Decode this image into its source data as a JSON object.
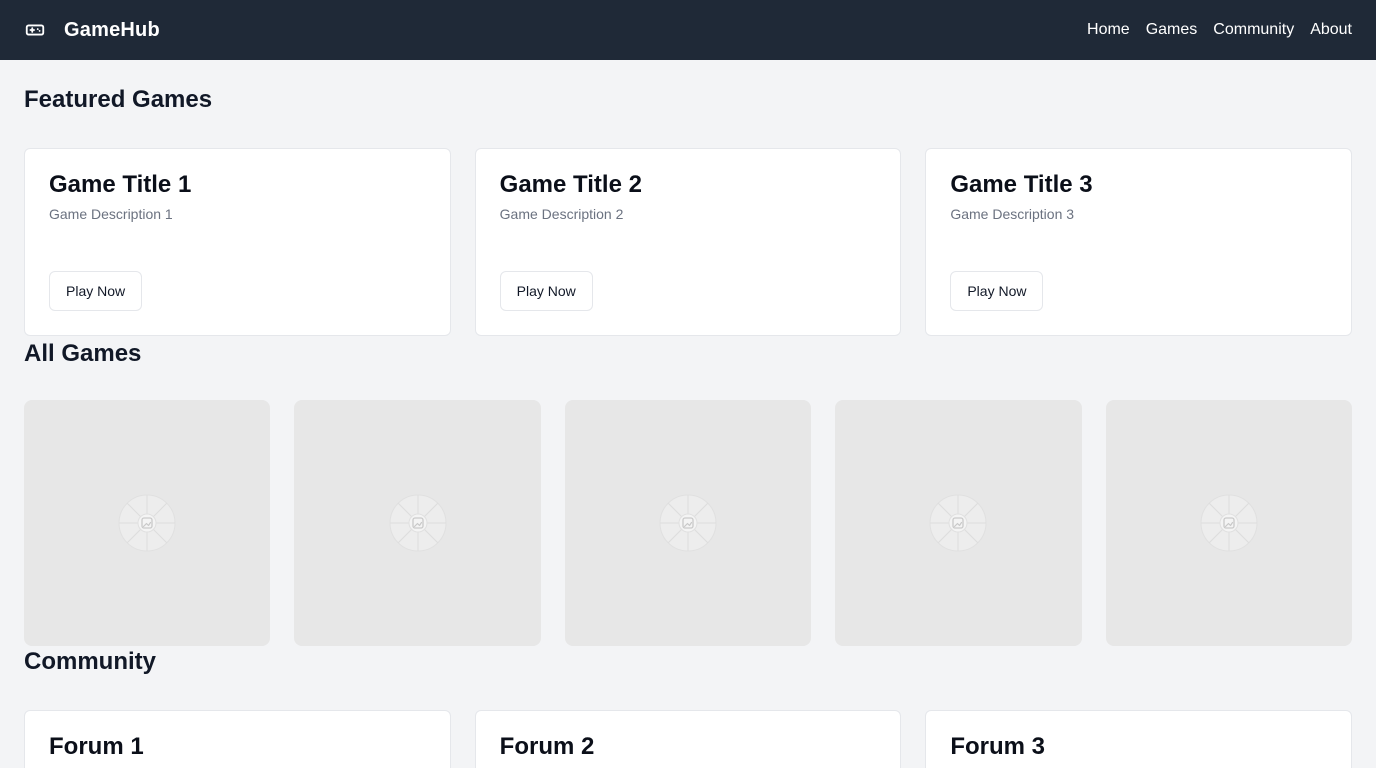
{
  "header": {
    "brand": "GameHub",
    "nav": [
      {
        "label": "Home"
      },
      {
        "label": "Games"
      },
      {
        "label": "Community"
      },
      {
        "label": "About"
      }
    ],
    "colors": {
      "background": "#1f2937",
      "text": "#ffffff"
    }
  },
  "featured": {
    "title": "Featured Games",
    "cards": [
      {
        "title": "Game Title 1",
        "description": "Game Description 1",
        "button": "Play Now"
      },
      {
        "title": "Game Title 2",
        "description": "Game Description 2",
        "button": "Play Now"
      },
      {
        "title": "Game Title 3",
        "description": "Game Description 3",
        "button": "Play Now"
      }
    ]
  },
  "all_games": {
    "title": "All Games",
    "items": [
      {
        "icon": "image-placeholder-icon"
      },
      {
        "icon": "image-placeholder-icon"
      },
      {
        "icon": "image-placeholder-icon"
      },
      {
        "icon": "image-placeholder-icon"
      },
      {
        "icon": "image-placeholder-icon"
      }
    ]
  },
  "community": {
    "title": "Community",
    "forums": [
      {
        "title": "Forum 1"
      },
      {
        "title": "Forum 2"
      },
      {
        "title": "Forum 3"
      }
    ]
  },
  "theme": {
    "page_bg": "#f3f4f6",
    "card_bg": "#ffffff",
    "thumb_bg": "#e7e7e7",
    "border": "#e5e7eb",
    "muted_text": "#6b7280"
  }
}
